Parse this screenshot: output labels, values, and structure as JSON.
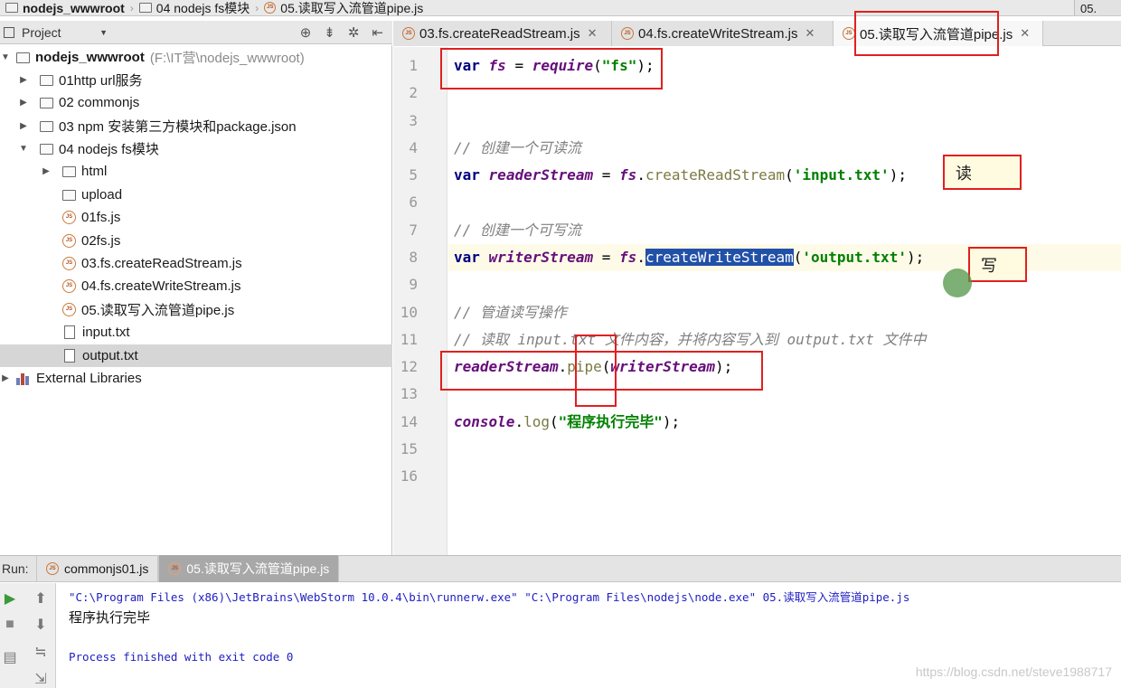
{
  "breadcrumb": {
    "items": [
      "nodejs_wwwroot",
      "04 nodejs fs模块",
      "05.读取写入流管道pipe.js"
    ],
    "right_label": "05."
  },
  "project_panel": {
    "selector_label": "Project",
    "tree": [
      {
        "label": "nodejs_wwwroot",
        "path": "(F:\\IT营\\nodejs_wwwroot)"
      },
      {
        "label": "01http url服务"
      },
      {
        "label": "02 commonjs"
      },
      {
        "label": "03 npm 安装第三方模块和package.json"
      },
      {
        "label": "04 nodejs fs模块"
      },
      {
        "label": "html"
      },
      {
        "label": "upload"
      },
      {
        "label": "01fs.js"
      },
      {
        "label": "02fs.js"
      },
      {
        "label": "03.fs.createReadStream.js"
      },
      {
        "label": "04.fs.createWriteStream.js"
      },
      {
        "label": "05.读取写入流管道pipe.js"
      },
      {
        "label": "input.txt"
      },
      {
        "label": "output.txt"
      },
      {
        "label": "External Libraries"
      }
    ]
  },
  "tabs": [
    {
      "label": "03.fs.createReadStream.js"
    },
    {
      "label": "04.fs.createWriteStream.js"
    },
    {
      "label": "05.读取写入流管道pipe.js"
    }
  ],
  "editor": {
    "line_numbers": [
      "1",
      "2",
      "3",
      "4",
      "5",
      "6",
      "7",
      "8",
      "9",
      "10",
      "11",
      "12",
      "13",
      "14",
      "15",
      "16"
    ],
    "l1": {
      "kw": "var",
      "v": "fs",
      "eq": " = ",
      "fn": "require",
      "p1": "(",
      "s": "\"fs\"",
      "p2": ");"
    },
    "l4": "// 创建一个可读流",
    "l5": {
      "kw": "var",
      "v": "readerStream",
      "eq": " = ",
      "obj": "fs",
      "dot": ".",
      "fn": "createReadStream",
      "p1": "(",
      "s": "'input.txt'",
      "p2": ");"
    },
    "l7": "// 创建一个可写流",
    "l8": {
      "kw": "var",
      "v": "writerStream",
      "eq": " = ",
      "obj": "fs",
      "dot": ".",
      "fn": "createWriteStream",
      "p1": "(",
      "s": "'output.txt'",
      "p2": ");"
    },
    "l10": "// 管道读写操作",
    "l11": "// 读取 input.txt 文件内容，并将内容写入到 output.txt 文件中",
    "l12": {
      "v1": "readerStream",
      "dot": ".",
      "fn": "pipe",
      "p1": "(",
      "v2": "writerStream",
      "p2": ");"
    },
    "l14": {
      "obj": "console",
      "dot": ".",
      "fn": "log",
      "p1": "(",
      "s": "\"程序执行完毕\"",
      "p2": ");"
    },
    "notes": {
      "read": "读",
      "write": "写"
    }
  },
  "run": {
    "label": "Run:",
    "tabs": [
      "commonjs01.js",
      "05.读取写入流管道pipe.js"
    ],
    "console": {
      "command": "\"C:\\Program Files (x86)\\JetBrains\\WebStorm 10.0.4\\bin\\runnerw.exe\" \"C:\\Program Files\\nodejs\\node.exe\" 05.读取写入流管道pipe.js",
      "output": "程序执行完毕",
      "exit": "Process finished with exit code 0"
    }
  },
  "watermark": "https://blog.csdn.net/steve1988717"
}
